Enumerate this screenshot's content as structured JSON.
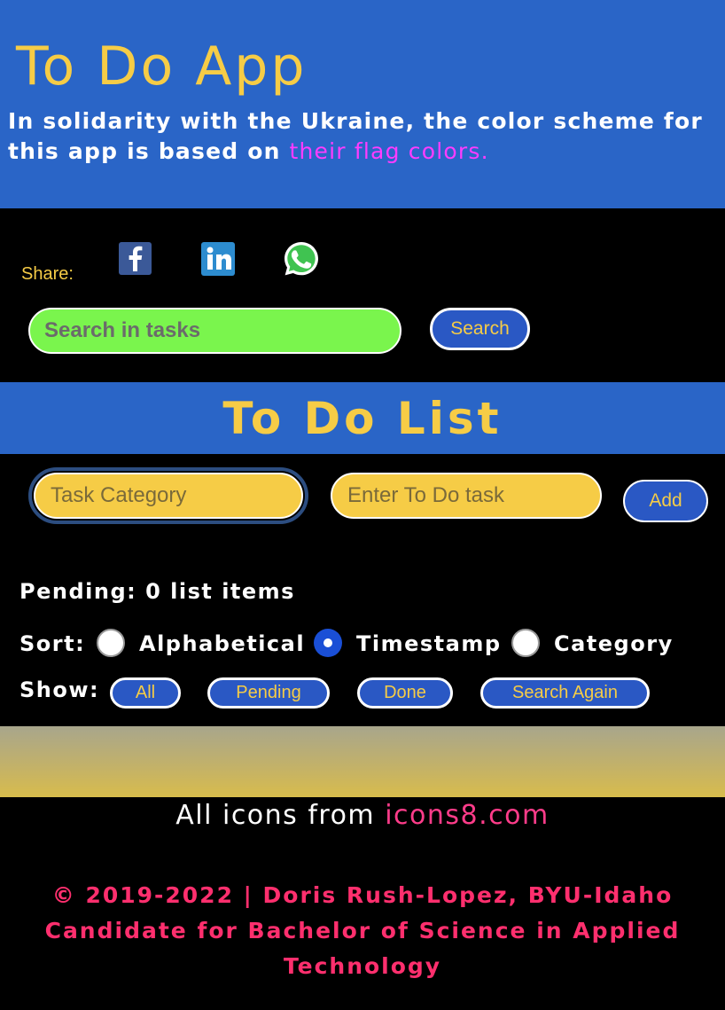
{
  "header": {
    "title": "To Do App",
    "intro_text": "In solidarity with the Ukraine, the color scheme for this app is based on ",
    "intro_link": "their flag colors."
  },
  "share": {
    "label": "Share:",
    "icons": [
      "facebook-icon",
      "linkedin-icon",
      "whatsapp-icon"
    ]
  },
  "search": {
    "placeholder": "Search in tasks",
    "button_label": "Search"
  },
  "list": {
    "title": "To Do List",
    "category_placeholder": "Task Category",
    "task_placeholder": "Enter To Do task",
    "add_label": "Add",
    "pending_text": "Pending: 0 list items"
  },
  "sort": {
    "label": "Sort:",
    "options": [
      "Alphabetical",
      "Timestamp",
      "Category"
    ],
    "selected": "Timestamp"
  },
  "show": {
    "label": "Show:",
    "buttons": [
      "All",
      "Pending",
      "Done",
      "Search Again"
    ]
  },
  "footer": {
    "icons_text": "All icons from ",
    "icons_link": "icons8.com",
    "copyright": "© 2019-2022 | Doris Rush-Lopez, BYU-Idaho Candidate for Bachelor of Science in Applied Technology"
  },
  "colors": {
    "blue": "#2a65c7",
    "yellow": "#f6cc46",
    "green": "#7af54d",
    "magenta": "#ff3cff",
    "pink": "#ff2f6e"
  }
}
